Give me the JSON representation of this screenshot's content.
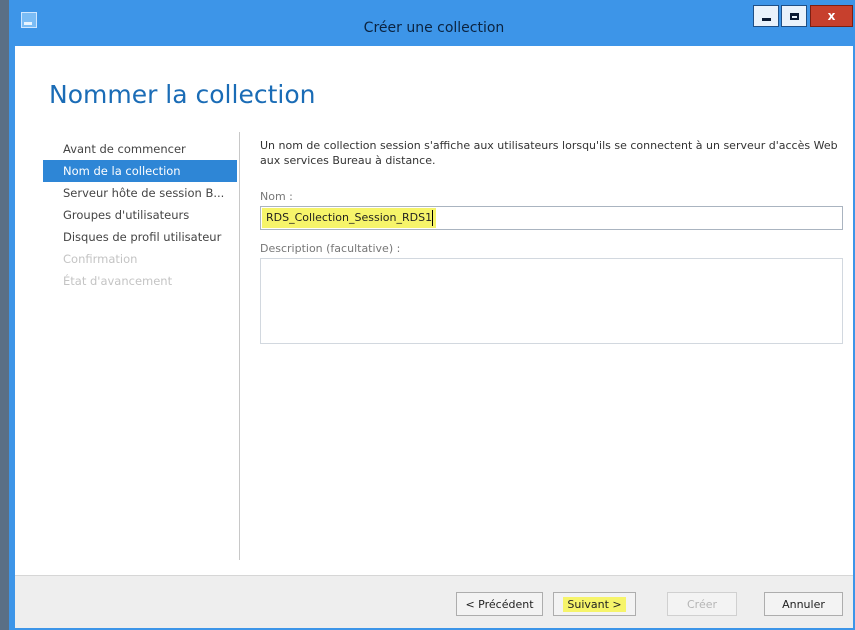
{
  "window": {
    "title": "Créer une collection"
  },
  "page": {
    "title": "Nommer la collection"
  },
  "sidebar": {
    "items": [
      {
        "label": "Avant de commencer",
        "state": "normal"
      },
      {
        "label": "Nom de la collection",
        "state": "active"
      },
      {
        "label": "Serveur hôte de session B...",
        "state": "normal"
      },
      {
        "label": "Groupes d'utilisateurs",
        "state": "normal"
      },
      {
        "label": "Disques de profil utilisateur",
        "state": "normal"
      },
      {
        "label": "Confirmation",
        "state": "disabled"
      },
      {
        "label": "État d'avancement",
        "state": "disabled"
      }
    ]
  },
  "content": {
    "description": "Un nom de collection session s'affiche aux utilisateurs lorsqu'ils se connectent à un serveur d'accès Web aux services Bureau à distance.",
    "name_label": "Nom :",
    "name_value": "RDS_Collection_Session_RDS1",
    "description_label": "Description (facultative) :",
    "description_value": ""
  },
  "footer": {
    "prev_label": "< Précédent",
    "next_label": "Suivant >",
    "create_label": "Créer",
    "cancel_label": "Annuler"
  },
  "colors": {
    "titlebar": "#3d95e8",
    "accent": "#1a6cb6",
    "active_item": "#2e86d6",
    "highlight": "#f6f46a",
    "close_button": "#c7402d"
  }
}
